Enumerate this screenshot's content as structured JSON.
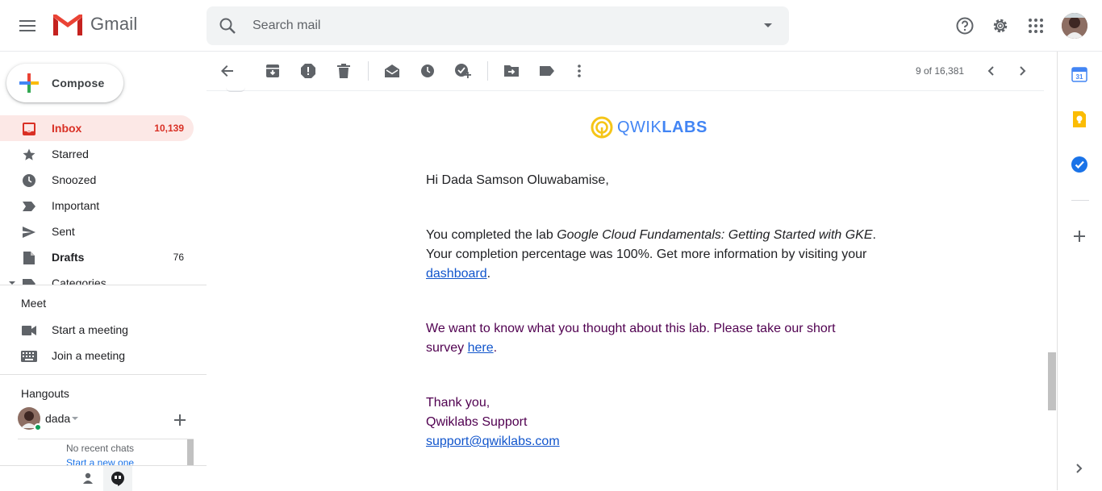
{
  "app": {
    "title": "Gmail"
  },
  "search": {
    "placeholder": "Search mail"
  },
  "compose": {
    "label": "Compose"
  },
  "nav": {
    "items": [
      {
        "label": "Inbox",
        "count": "10,139"
      },
      {
        "label": "Starred",
        "count": ""
      },
      {
        "label": "Snoozed",
        "count": ""
      },
      {
        "label": "Important",
        "count": ""
      },
      {
        "label": "Sent",
        "count": ""
      },
      {
        "label": "Drafts",
        "count": "76"
      },
      {
        "label": "Categories",
        "count": ""
      }
    ]
  },
  "meet": {
    "title": "Meet",
    "start": "Start a meeting",
    "join": "Join a meeting"
  },
  "hangouts": {
    "title": "Hangouts",
    "user": "dada",
    "no_recent": "No recent chats",
    "start_new": "Start a new one"
  },
  "toolbar": {
    "pager": "9 of 16,381"
  },
  "email": {
    "brand_q": "QWIK",
    "brand_l": "LABS",
    "greeting": "Hi Dada Samson Oluwabamise,",
    "p1_a": "You completed the lab ",
    "p1_lab": "Google Cloud Fundamentals: Getting Started with GKE",
    "p1_b": ".",
    "p1_c": "Your completion percentage was 100%. Get more information by visiting your",
    "p1_link": "dashboard",
    "p1_end": ".",
    "p2_a": "We want to know what you thought about this lab. Please take our short",
    "p2_b": "survey ",
    "p2_link": "here",
    "p2_end": ".",
    "thanks": "Thank you,",
    "sign": "Qwiklabs Support",
    "support": "support@qwiklabs.com"
  },
  "colors": {
    "accent": "#d93025",
    "link": "#1155cc",
    "purple_text": "#500050",
    "active_bg": "#fce8e6"
  },
  "icons": [
    "menu-icon",
    "gmail-logo-icon",
    "search-icon",
    "dropdown-icon",
    "help-icon",
    "settings-icon",
    "apps-icon",
    "back-icon",
    "archive-icon",
    "report-spam-icon",
    "delete-icon",
    "mark-unread-icon",
    "snooze-icon",
    "add-to-tasks-icon",
    "move-to-icon",
    "label-icon",
    "more-icon",
    "chevron-left-icon",
    "chevron-right-icon",
    "calendar-icon",
    "keep-icon",
    "tasks-icon",
    "plus-icon"
  ]
}
